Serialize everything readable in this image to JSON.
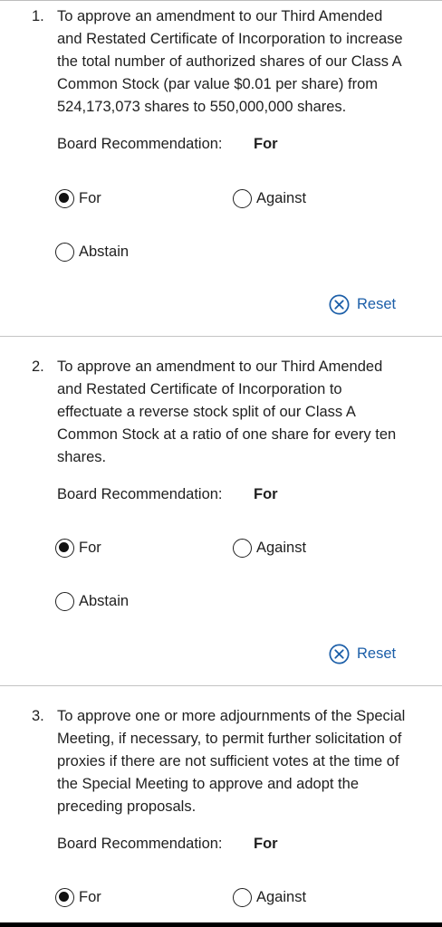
{
  "board_recommendation_label": "Board Recommendation:",
  "reset_label": "Reset",
  "proposals": [
    {
      "number": "1.",
      "lines": [
        "To approve an amendment to our Third Amended",
        "and Restated Certificate of Incorporation to increase",
        "the total number of authorized shares of our Class A",
        "Common Stock (par value $0.01 per share) from",
        "524,173,073 shares to 550,000,000 shares."
      ],
      "recommendation": "For",
      "options": {
        "for": "For",
        "against": "Against",
        "abstain": "Abstain"
      },
      "selected": "For"
    },
    {
      "number": "2.",
      "lines": [
        "To approve an amendment to our Third Amended",
        "and Restated Certificate of Incorporation to",
        "effectuate a reverse stock split of our Class A",
        "Common Stock at a ratio of one share for every ten",
        "shares."
      ],
      "recommendation": "For",
      "options": {
        "for": "For",
        "against": "Against",
        "abstain": "Abstain"
      },
      "selected": "For"
    },
    {
      "number": "3.",
      "lines": [
        "To approve one or more adjournments of the Special",
        "Meeting, if necessary, to permit further solicitation of",
        "proxies if there are not sufficient votes at the time of",
        "the Special Meeting to approve and adopt the",
        "preceding proposals."
      ],
      "recommendation": "For",
      "options": {
        "for": "For",
        "against": "Against"
      },
      "selected": "For"
    }
  ]
}
